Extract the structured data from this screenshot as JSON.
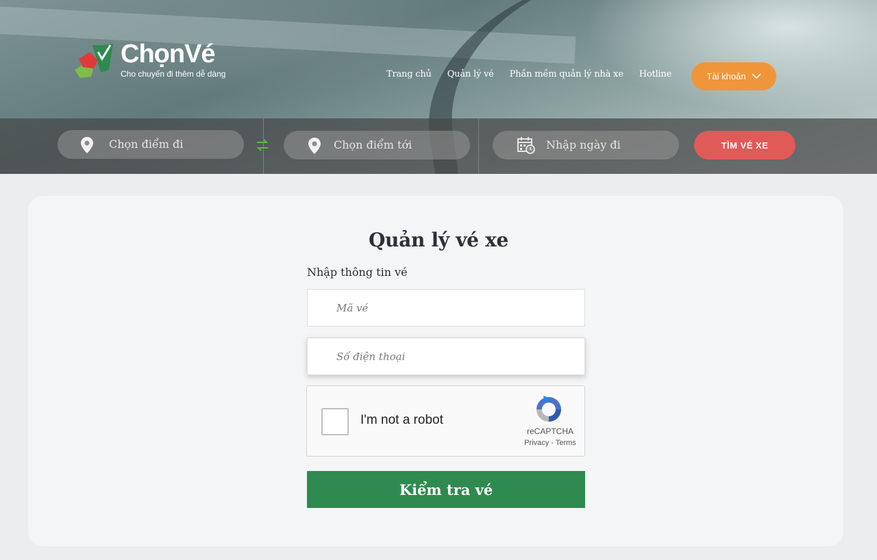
{
  "brand": {
    "name": "ChọnVé",
    "tagline": "Cho chuyến đi thêm dễ dàng"
  },
  "nav": {
    "items": [
      {
        "label": "Trang chủ"
      },
      {
        "label": "Quản lý vé"
      },
      {
        "label": "Phần mềm quản lý nhà xe"
      },
      {
        "label": "Hotline"
      }
    ],
    "account_label": "Tài khoản"
  },
  "search": {
    "from_placeholder": "Chọn điểm đi",
    "to_placeholder": "Chọn điểm tới",
    "date_placeholder": "Nhập ngày đi",
    "button_label": "TÌM VÉ XE"
  },
  "form": {
    "title": "Quản lý vé xe",
    "subtitle": "Nhập thông tin vé",
    "ticket_placeholder": "Mã vé",
    "phone_placeholder": "Số điện thoại",
    "submit_label": "Kiểm tra vé"
  },
  "captcha": {
    "label": "I'm not a robot",
    "brand": "reCAPTCHA",
    "links": "Privacy - Terms"
  },
  "colors": {
    "accent_orange": "#f0953a",
    "search_red": "#e05a58",
    "submit_green": "#2e8a4e"
  }
}
